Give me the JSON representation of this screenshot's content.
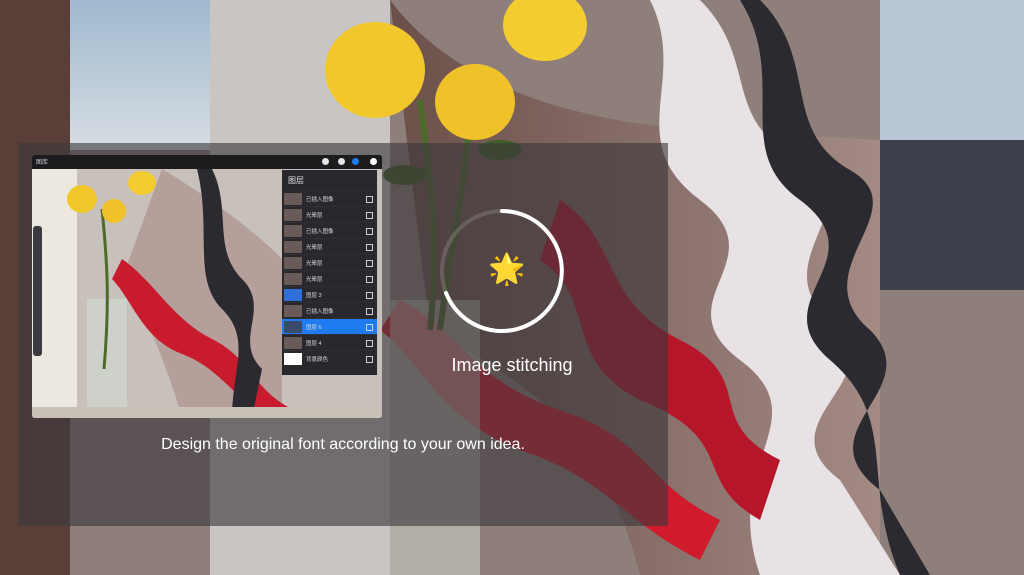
{
  "loading": {
    "status_text": "Image stitching",
    "icon": "sparkle-star-icon"
  },
  "caption": {
    "text": "Design the original font according to your own idea."
  },
  "preview": {
    "toolbar_title": "图库",
    "layers_panel": {
      "title": "图层",
      "items": [
        {
          "label": "已插入图像"
        },
        {
          "label": "光晕层"
        },
        {
          "label": "已插入图像"
        },
        {
          "label": "光晕层"
        },
        {
          "label": "光晕层"
        },
        {
          "label": "光晕层"
        },
        {
          "label": "图层 3"
        },
        {
          "label": "已插入图像"
        },
        {
          "label": "图层 6",
          "active": true
        },
        {
          "label": "图层 4"
        },
        {
          "label": "背景颜色"
        }
      ]
    }
  },
  "colors": {
    "overlay": "#3c373c",
    "accent_blue": "#1f7bf2",
    "spinner": "#ffffff"
  }
}
